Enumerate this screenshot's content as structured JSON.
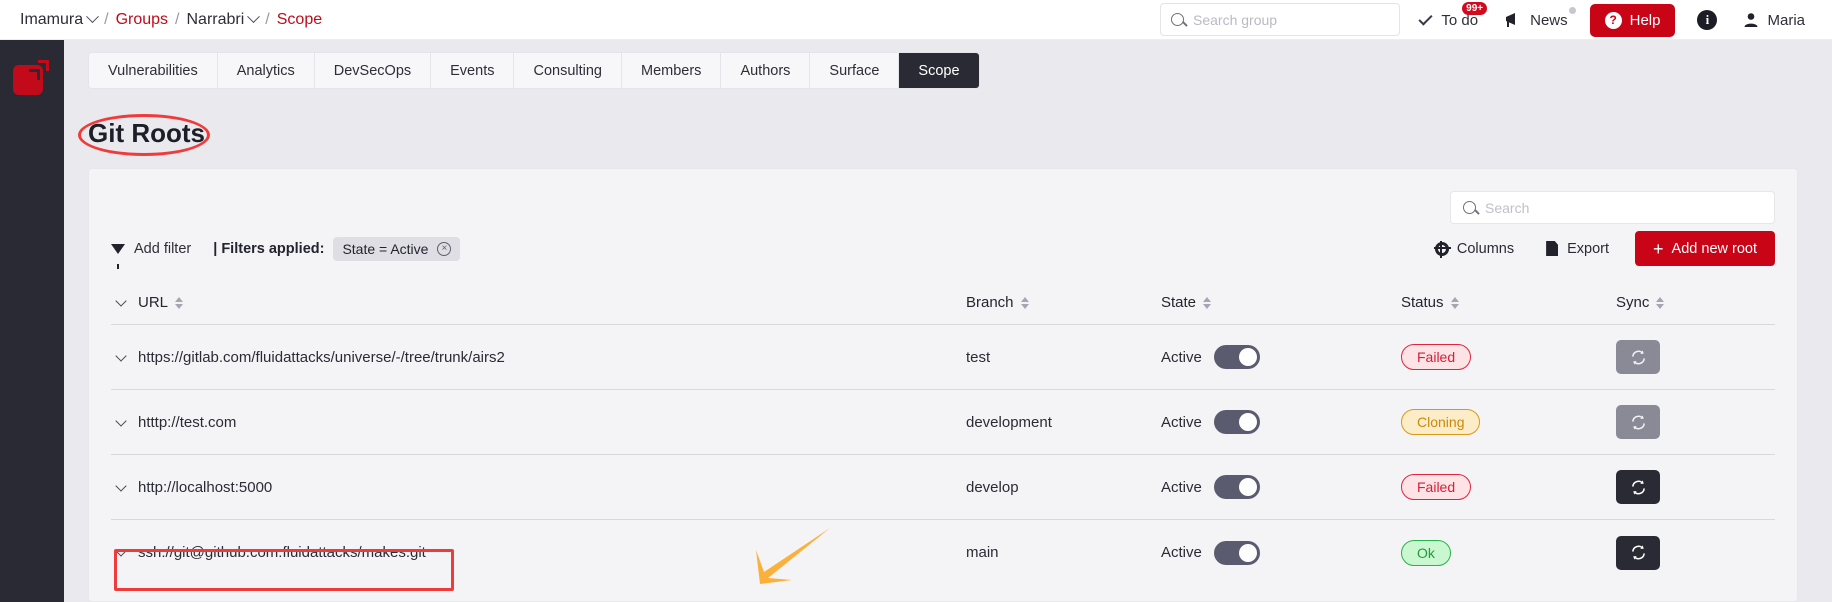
{
  "header": {
    "breadcrumb": [
      {
        "label": "Imamura",
        "link": false,
        "caret": true
      },
      {
        "label": "Groups",
        "link": true,
        "caret": false
      },
      {
        "label": "Narrabri",
        "link": false,
        "caret": true
      },
      {
        "label": "Scope",
        "link": true,
        "caret": false
      }
    ],
    "separator": "/",
    "search": {
      "value": "",
      "placeholder": "Search group",
      "icon": "search-icon"
    },
    "todo": {
      "label": "To do",
      "badge": "99+",
      "icon": "check-icon"
    },
    "news": {
      "label": "News",
      "icon": "megaphone-icon",
      "dot": true
    },
    "help": {
      "label": "Help",
      "icon": "question-mark-icon"
    },
    "info": {
      "label": "i",
      "icon": "info-icon"
    },
    "user": {
      "label": "Maria",
      "icon": "user-icon"
    }
  },
  "tabs": [
    {
      "label": "Vulnerabilities",
      "active": false
    },
    {
      "label": "Analytics",
      "active": false
    },
    {
      "label": "DevSecOps",
      "active": false
    },
    {
      "label": "Events",
      "active": false
    },
    {
      "label": "Consulting",
      "active": false
    },
    {
      "label": "Members",
      "active": false
    },
    {
      "label": "Authors",
      "active": false
    },
    {
      "label": "Surface",
      "active": false
    },
    {
      "label": "Scope",
      "active": true
    }
  ],
  "page": {
    "title": "Git Roots"
  },
  "toolbar": {
    "add_filter": "Add filter",
    "filters_applied_label": "| Filters applied:",
    "filter_chip": "State = Active",
    "filter_chip_close": "×",
    "columns": "Columns",
    "export": "Export",
    "add_new_root": "Add new root",
    "plus": "+"
  },
  "table_search": {
    "value": "",
    "placeholder": "Search",
    "icon": "search-icon"
  },
  "table": {
    "columns": [
      {
        "key": "url",
        "label": "URL",
        "sortable": true
      },
      {
        "key": "branch",
        "label": "Branch",
        "sortable": true
      },
      {
        "key": "state",
        "label": "State",
        "sortable": true
      },
      {
        "key": "status",
        "label": "Status",
        "sortable": true
      },
      {
        "key": "sync",
        "label": "Sync",
        "sortable": true
      }
    ],
    "rows": [
      {
        "url": "https://gitlab.com/fluidattacks/universe/-/tree/trunk/airs2",
        "branch": "test",
        "state": "Active",
        "state_on": true,
        "status": "Failed",
        "status_kind": "failed",
        "sync_enabled": false,
        "highlighted": false
      },
      {
        "url": "htttp://test.com",
        "branch": "development",
        "state": "Active",
        "state_on": true,
        "status": "Cloning",
        "status_kind": "cloning",
        "sync_enabled": false,
        "highlighted": false
      },
      {
        "url": "http://localhost:5000",
        "branch": "develop",
        "state": "Active",
        "state_on": true,
        "status": "Failed",
        "status_kind": "failed",
        "sync_enabled": true,
        "highlighted": false
      },
      {
        "url": "ssh://git@github.com:fluidattacks/makes.git",
        "branch": "main",
        "state": "Active",
        "state_on": true,
        "status": "Ok",
        "status_kind": "ok",
        "sync_enabled": true,
        "highlighted": true
      }
    ]
  },
  "colors": {
    "brand_red": "#c90417",
    "accent_red": "#bf0b1a",
    "dark": "#2a2a35",
    "annotation_red": "#ef3b3b",
    "annotation_orange": "#fcb githubl"
  },
  "annotations": {
    "title_ellipse": "red-ellipse",
    "row_box": "red-rectangle",
    "arrow": "orange-arrow"
  }
}
